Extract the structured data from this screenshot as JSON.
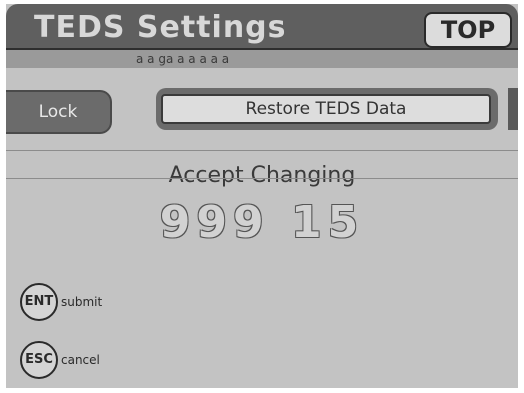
{
  "header": {
    "title": "TEDS Settings",
    "top_button_label": "TOP",
    "strip_text": "a a ga a a a a a"
  },
  "tabs": {
    "lock_label": "Lock",
    "restore_label": "Restore TEDS Data"
  },
  "status": {
    "message": "Accept Changing",
    "value": "999 15"
  },
  "keys": [
    {
      "key": "ENT",
      "label": "submit"
    },
    {
      "key": "ESC",
      "label": "cancel"
    }
  ],
  "colors": {
    "screen_bg": "#c3c3c3",
    "title_bg": "#5f5f5f",
    "tab_bg": "#6b6b6b"
  }
}
